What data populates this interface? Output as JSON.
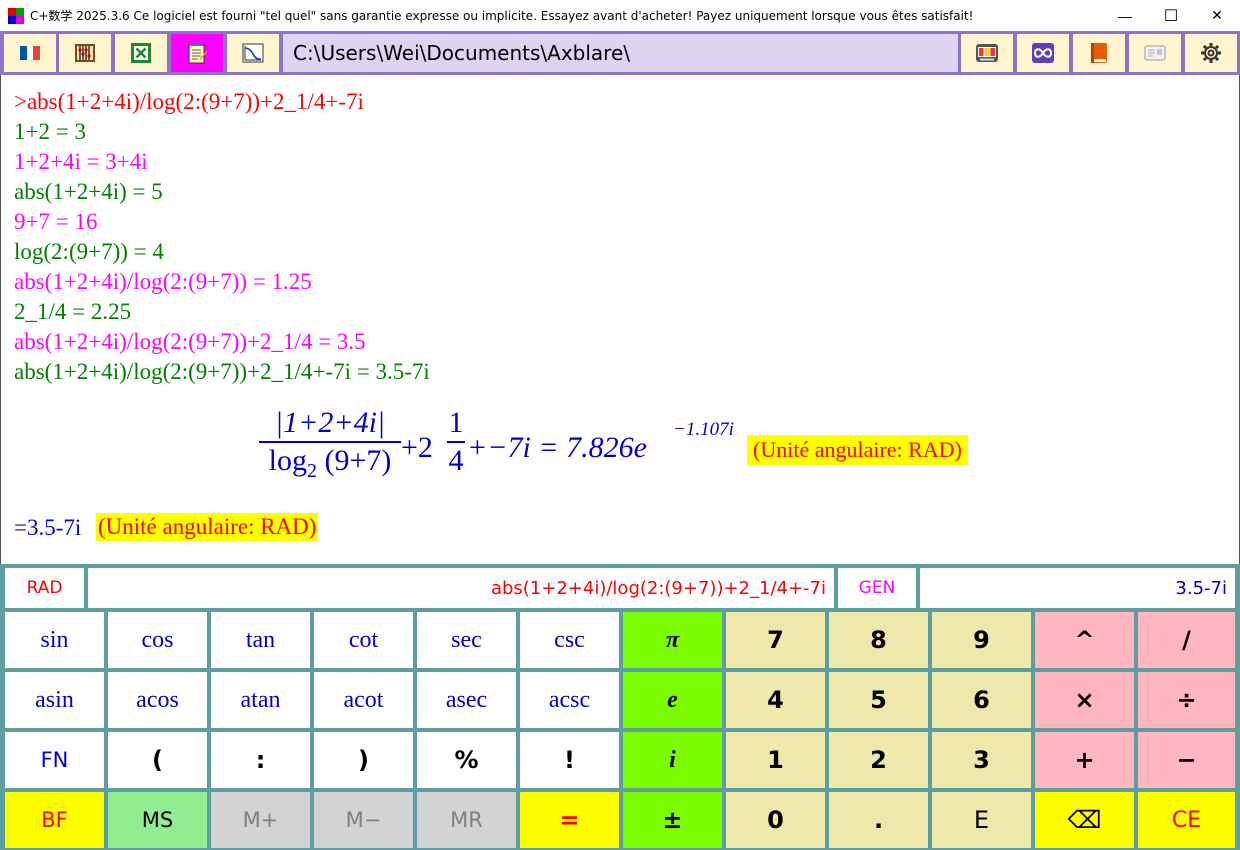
{
  "window": {
    "title": "C+数学 2025.3.6 Ce logiciel est fourni \"tel quel\" sans garantie expresse ou implicite. Essayez avant d'acheter! Payez uniquement lorsque vous êtes satisfait!",
    "minimize_glyph": "—",
    "maximize_glyph": "☐",
    "close_glyph": "✕"
  },
  "toolbar": {
    "path": "C:\\Users\\Wei\\Documents\\Axblare\\"
  },
  "output": {
    "lines": [
      {
        "text": ">abs(1+2+4i)/log(2:(9+7))+2_1/4+-7i",
        "color": "red"
      },
      {
        "text": "1+2 = 3",
        "color": "green"
      },
      {
        "text": "1+2+4i = 3+4i",
        "color": "magenta"
      },
      {
        "text": "abs(1+2+4i) = 5",
        "color": "green"
      },
      {
        "text": "9+7 = 16",
        "color": "magenta"
      },
      {
        "text": "log(2:(9+7)) = 4",
        "color": "green"
      },
      {
        "text": "abs(1+2+4i)/log(2:(9+7)) = 1.25",
        "color": "magenta"
      },
      {
        "text": "2_1/4 = 2.25",
        "color": "green"
      },
      {
        "text": "abs(1+2+4i)/log(2:(9+7))+2_1/4 = 3.5",
        "color": "magenta"
      },
      {
        "text": "abs(1+2+4i)/log(2:(9+7))+2_1/4+-7i = 3.5-7i",
        "color": "green"
      }
    ],
    "formula": {
      "frac1_num": "|1+2+4i|",
      "frac1_den_log": "log",
      "frac1_den_sub": "2",
      "frac1_den_arg": "(9+7)",
      "plus_two": "+2",
      "frac2_num": "1",
      "frac2_den": "4",
      "tail": "+−7i = 7.826e",
      "exponent": "−1.107i",
      "unit": "(Unité angulaire: RAD)"
    },
    "result": "=3.5-7i",
    "result_unit": "(Unité angulaire: RAD)"
  },
  "calculator": {
    "angle_mode": "RAD",
    "expression": "abs(1+2+4i)/log(2:(9+7))+2_1/4+-7i",
    "format_mode": "GEN",
    "result": "3.5-7i",
    "rows": [
      [
        "sin",
        "cos",
        "tan",
        "cot",
        "sec",
        "csc",
        "π",
        "7",
        "8",
        "9",
        "^",
        "/"
      ],
      [
        "asin",
        "acos",
        "atan",
        "acot",
        "asec",
        "acsc",
        "e",
        "4",
        "5",
        "6",
        "×",
        "÷"
      ],
      [
        "FN",
        "(",
        ":",
        ")",
        "%",
        "!",
        "i",
        "1",
        "2",
        "3",
        "+",
        "−"
      ],
      [
        "BF",
        "MS",
        "M+",
        "M−",
        "MR",
        "=",
        "±",
        "0",
        ".",
        "E",
        "⌫",
        "CE"
      ]
    ]
  },
  "colors": {
    "toolbar_bg": "#8e74c9",
    "keypad_border": "#5f9ea0",
    "pi_e_i_key": "#7cfc00",
    "digit_key": "#eee8aa",
    "operator_key": "#ffb6c1"
  }
}
